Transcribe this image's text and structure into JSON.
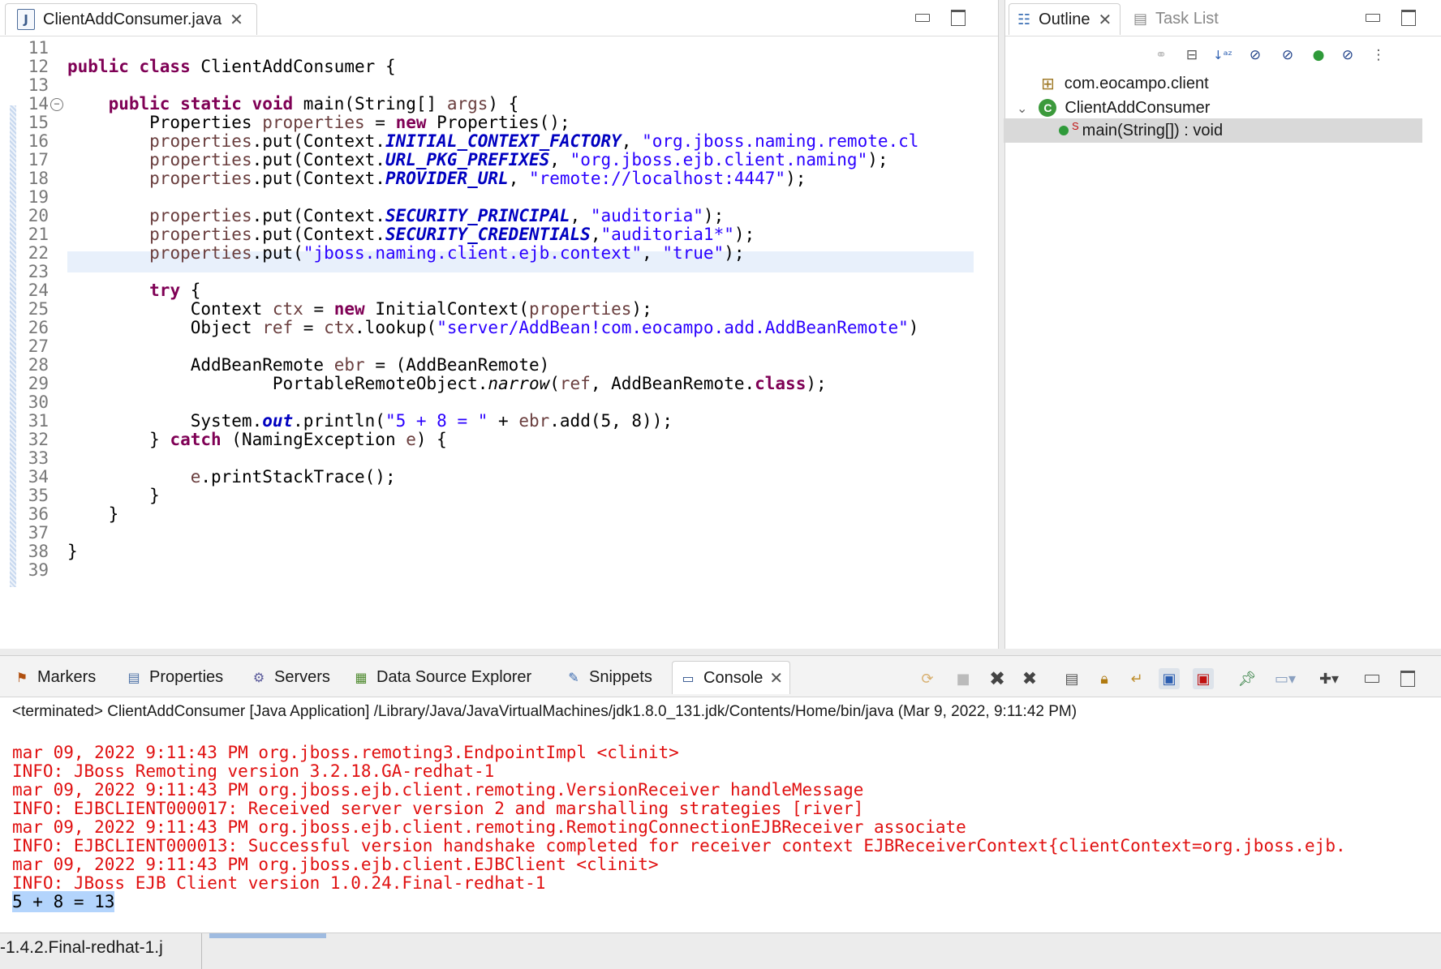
{
  "editor": {
    "tab_title": "ClientAddConsumer.java",
    "lines": [
      {
        "n": "11",
        "segs": []
      },
      {
        "n": "12",
        "segs": [
          {
            "t": "public class ",
            "c": "kw"
          },
          {
            "t": "ClientAddConsumer {",
            "c": "tx"
          }
        ]
      },
      {
        "n": "13",
        "segs": []
      },
      {
        "n": "14",
        "fold": true,
        "segs": [
          {
            "t": "    "
          },
          {
            "t": "public static void ",
            "c": "kw"
          },
          {
            "t": "main(String[] "
          },
          {
            "t": "args",
            "c": "var"
          },
          {
            "t": ") {"
          }
        ]
      },
      {
        "n": "15",
        "segs": [
          {
            "t": "        Properties "
          },
          {
            "t": "properties",
            "c": "var"
          },
          {
            "t": " = "
          },
          {
            "t": "new ",
            "c": "kw"
          },
          {
            "t": "Properties();"
          }
        ]
      },
      {
        "n": "16",
        "segs": [
          {
            "t": "        "
          },
          {
            "t": "properties",
            "c": "var"
          },
          {
            "t": ".put(Context."
          },
          {
            "t": "INITIAL_CONTEXT_FACTORY",
            "c": "const"
          },
          {
            "t": ", "
          },
          {
            "t": "\"org.jboss.naming.remote.cl",
            "c": "str"
          }
        ]
      },
      {
        "n": "17",
        "segs": [
          {
            "t": "        "
          },
          {
            "t": "properties",
            "c": "var"
          },
          {
            "t": ".put(Context."
          },
          {
            "t": "URL_PKG_PREFIXES",
            "c": "const"
          },
          {
            "t": ", "
          },
          {
            "t": "\"org.jboss.ejb.client.naming\"",
            "c": "str"
          },
          {
            "t": ");"
          }
        ]
      },
      {
        "n": "18",
        "segs": [
          {
            "t": "        "
          },
          {
            "t": "properties",
            "c": "var"
          },
          {
            "t": ".put(Context."
          },
          {
            "t": "PROVIDER_URL",
            "c": "const"
          },
          {
            "t": ", "
          },
          {
            "t": "\"remote://localhost:4447\"",
            "c": "str"
          },
          {
            "t": ");"
          }
        ]
      },
      {
        "n": "19",
        "segs": []
      },
      {
        "n": "20",
        "segs": [
          {
            "t": "        "
          },
          {
            "t": "properties",
            "c": "var"
          },
          {
            "t": ".put(Context."
          },
          {
            "t": "SECURITY_PRINCIPAL",
            "c": "const"
          },
          {
            "t": ", "
          },
          {
            "t": "\"auditoria\"",
            "c": "str"
          },
          {
            "t": ");"
          }
        ]
      },
      {
        "n": "21",
        "segs": [
          {
            "t": "        "
          },
          {
            "t": "properties",
            "c": "var"
          },
          {
            "t": ".put(Context."
          },
          {
            "t": "SECURITY_CREDENTIALS",
            "c": "const"
          },
          {
            "t": ","
          },
          {
            "t": "\"auditoria1*\"",
            "c": "str"
          },
          {
            "t": ");"
          }
        ]
      },
      {
        "n": "22",
        "segs": [
          {
            "t": "        "
          },
          {
            "t": "properties",
            "c": "var"
          },
          {
            "t": ".put("
          },
          {
            "t": "\"jboss.naming.client.ejb.context\"",
            "c": "str"
          },
          {
            "t": ", "
          },
          {
            "t": "\"true\"",
            "c": "str"
          },
          {
            "t": ");"
          }
        ]
      },
      {
        "n": "23",
        "segs": []
      },
      {
        "n": "24",
        "segs": [
          {
            "t": "        "
          },
          {
            "t": "try ",
            "c": "kw"
          },
          {
            "t": "{"
          }
        ]
      },
      {
        "n": "25",
        "segs": [
          {
            "t": "            Context "
          },
          {
            "t": "ctx",
            "c": "var"
          },
          {
            "t": " = "
          },
          {
            "t": "new ",
            "c": "kw"
          },
          {
            "t": "InitialContext("
          },
          {
            "t": "properties",
            "c": "var"
          },
          {
            "t": ");"
          }
        ]
      },
      {
        "n": "26",
        "segs": [
          {
            "t": "            Object "
          },
          {
            "t": "ref",
            "c": "var"
          },
          {
            "t": " = "
          },
          {
            "t": "ctx",
            "c": "var"
          },
          {
            "t": ".lookup("
          },
          {
            "t": "\"server/AddBean!com.eocampo.add.AddBeanRemote\"",
            "c": "str"
          },
          {
            "t": ")"
          }
        ]
      },
      {
        "n": "27",
        "segs": []
      },
      {
        "n": "28",
        "segs": [
          {
            "t": "            AddBeanRemote "
          },
          {
            "t": "ebr",
            "c": "var"
          },
          {
            "t": " = (AddBeanRemote)"
          }
        ]
      },
      {
        "n": "29",
        "segs": [
          {
            "t": "                    PortableRemoteObject."
          },
          {
            "t": "narrow",
            "c": "it"
          },
          {
            "t": "("
          },
          {
            "t": "ref",
            "c": "var"
          },
          {
            "t": ", AddBeanRemote."
          },
          {
            "t": "class",
            "c": "kw"
          },
          {
            "t": ");"
          }
        ]
      },
      {
        "n": "30",
        "segs": []
      },
      {
        "n": "31",
        "segs": [
          {
            "t": "            System."
          },
          {
            "t": "out",
            "c": "const"
          },
          {
            "t": ".println("
          },
          {
            "t": "\"5 + 8 = \"",
            "c": "str"
          },
          {
            "t": " + "
          },
          {
            "t": "ebr",
            "c": "var"
          },
          {
            "t": ".add(5, 8));"
          }
        ]
      },
      {
        "n": "32",
        "segs": [
          {
            "t": "        } "
          },
          {
            "t": "catch ",
            "c": "kw"
          },
          {
            "t": "(NamingException "
          },
          {
            "t": "e",
            "c": "var"
          },
          {
            "t": ") {"
          }
        ]
      },
      {
        "n": "33",
        "segs": []
      },
      {
        "n": "34",
        "segs": [
          {
            "t": "            "
          },
          {
            "t": "e",
            "c": "var"
          },
          {
            "t": ".printStackTrace();"
          }
        ]
      },
      {
        "n": "35",
        "segs": [
          {
            "t": "        }"
          }
        ]
      },
      {
        "n": "36",
        "segs": [
          {
            "t": "    }"
          }
        ]
      },
      {
        "n": "37",
        "segs": []
      },
      {
        "n": "38",
        "segs": [
          {
            "t": "}"
          }
        ]
      },
      {
        "n": "39",
        "segs": []
      }
    ]
  },
  "outline": {
    "tab_outline": "Outline",
    "tab_tasklist": "Task List",
    "package": "com.eocampo.client",
    "class_name": "ClientAddConsumer",
    "method": "main(String[]) : void"
  },
  "console": {
    "tabs": [
      "Markers",
      "Properties",
      "Servers",
      "Data Source Explorer",
      "Snippets",
      "Console"
    ],
    "header": "<terminated> ClientAddConsumer [Java Application] /Library/Java/JavaVirtualMachines/jdk1.8.0_131.jdk/Contents/Home/bin/java (Mar 9, 2022, 9:11:42 PM)",
    "lines": [
      "mar 09, 2022 9:11:43 PM org.jboss.remoting3.EndpointImpl <clinit>",
      "INFO: JBoss Remoting version 3.2.18.GA-redhat-1",
      "mar 09, 2022 9:11:43 PM org.jboss.ejb.client.remoting.VersionReceiver handleMessage",
      "INFO: EJBCLIENT000017: Received server version 2 and marshalling strategies [river]",
      "mar 09, 2022 9:11:43 PM org.jboss.ejb.client.remoting.RemotingConnectionEJBReceiver associate",
      "INFO: EJBCLIENT000013: Successful version handshake completed for receiver context EJBReceiverContext{clientContext=org.jboss.ejb.",
      "mar 09, 2022 9:11:43 PM org.jboss.ejb.client.EJBClient <clinit>",
      "INFO: JBoss EJB Client version 1.0.24.Final-redhat-1"
    ],
    "result": "5 + 8 = 13"
  },
  "statusbar": {
    "text": "-1.4.2.Final-redhat-1.j"
  },
  "colors": {
    "keyword": "#7f0055",
    "string": "#2a00ff",
    "constant": "#0000c0",
    "variable": "#6a3e3e",
    "console_red": "#e01010",
    "selection": "#b3d4fc"
  }
}
